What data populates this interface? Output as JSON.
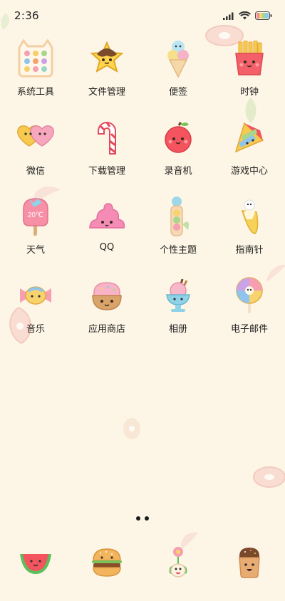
{
  "status_bar": {
    "time": "2:36",
    "icons": [
      "signal-icon",
      "wifi-icon",
      "battery-icon"
    ]
  },
  "apps": [
    {
      "label": "系统工具",
      "icon": "system-tools-icon"
    },
    {
      "label": "文件管理",
      "icon": "file-manager-icon"
    },
    {
      "label": "便签",
      "icon": "notes-icon"
    },
    {
      "label": "时钟",
      "icon": "clock-icon"
    },
    {
      "label": "微信",
      "icon": "wechat-icon"
    },
    {
      "label": "下载管理",
      "icon": "download-manager-icon"
    },
    {
      "label": "录音机",
      "icon": "recorder-icon"
    },
    {
      "label": "游戏中心",
      "icon": "game-center-icon"
    },
    {
      "label": "天气",
      "icon": "weather-icon",
      "badge": "20℃"
    },
    {
      "label": "QQ",
      "icon": "qq-icon"
    },
    {
      "label": "个性主题",
      "icon": "themes-icon"
    },
    {
      "label": "指南针",
      "icon": "compass-icon"
    },
    {
      "label": "音乐",
      "icon": "music-icon"
    },
    {
      "label": "应用商店",
      "icon": "app-store-icon"
    },
    {
      "label": "相册",
      "icon": "gallery-icon"
    },
    {
      "label": "电子邮件",
      "icon": "email-icon"
    }
  ],
  "page_indicator": {
    "pages": 2,
    "current": 1
  },
  "dock": [
    {
      "icon": "phone-watermelon-icon"
    },
    {
      "icon": "contacts-burger-icon"
    },
    {
      "icon": "messages-flower-icon"
    },
    {
      "icon": "browser-icecream-icon"
    }
  ],
  "colors": {
    "background": "#fdf6e6",
    "text": "#1e1e1e"
  }
}
